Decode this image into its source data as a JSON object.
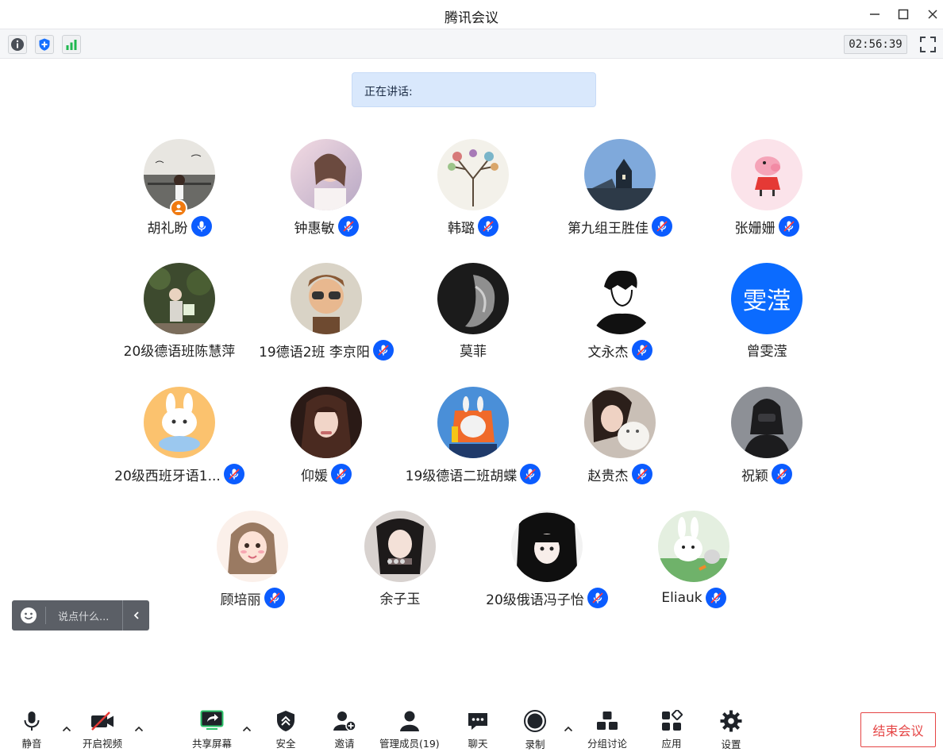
{
  "window": {
    "title": "腾讯会议"
  },
  "status": {
    "timer": "02:56:39"
  },
  "speaking": {
    "label": "正在讲话:"
  },
  "participants": [
    {
      "name": "胡礼盼",
      "mic": "on",
      "host": true,
      "avatar": "photo"
    },
    {
      "name": "钟惠敏",
      "mic": "muted",
      "avatar": "photo"
    },
    {
      "name": "韩璐",
      "mic": "muted",
      "avatar": "photo"
    },
    {
      "name": "第九组王胜佳",
      "mic": "muted",
      "avatar": "photo"
    },
    {
      "name": "张姗姗",
      "mic": "muted",
      "avatar": "photo"
    },
    {
      "name": "20级德语班陈慧萍",
      "mic": "none",
      "avatar": "photo"
    },
    {
      "name": "19德语2班 李京阳",
      "mic": "muted",
      "avatar": "photo"
    },
    {
      "name": "莫菲",
      "mic": "none",
      "avatar": "photo"
    },
    {
      "name": "文永杰",
      "mic": "muted",
      "avatar": "photo"
    },
    {
      "name": "曾雯滢",
      "mic": "none",
      "avatar": "letter",
      "avatar_text": "雯滢"
    },
    {
      "name": "20级西班牙语1...",
      "mic": "muted",
      "avatar": "photo"
    },
    {
      "name": "仰媛",
      "mic": "muted",
      "avatar": "photo"
    },
    {
      "name": "19级德语二班胡蝶",
      "mic": "muted",
      "avatar": "photo"
    },
    {
      "name": "赵贵杰",
      "mic": "muted",
      "avatar": "photo"
    },
    {
      "name": "祝颖",
      "mic": "muted",
      "avatar": "photo"
    },
    {
      "name": "顾培丽",
      "mic": "muted",
      "avatar": "photo"
    },
    {
      "name": "余子玉",
      "mic": "none",
      "avatar": "photo"
    },
    {
      "name": "20级俄语冯子怡",
      "mic": "muted",
      "avatar": "photo"
    },
    {
      "name": "Eliauk",
      "mic": "muted",
      "avatar": "photo"
    }
  ],
  "chat": {
    "placeholder": "说点什么..."
  },
  "toolbar": {
    "mute": "静音",
    "video": "开启视频",
    "share": "共享屏幕",
    "security": "安全",
    "invite": "邀请",
    "members": "管理成员(19)",
    "chat": "聊天",
    "record": "录制",
    "breakout": "分组讨论",
    "apps": "应用",
    "settings": "设置",
    "end": "结束会议"
  },
  "colors": {
    "accent": "#0b5cff",
    "end": "#e54545",
    "banner": "#d9e8fc"
  }
}
